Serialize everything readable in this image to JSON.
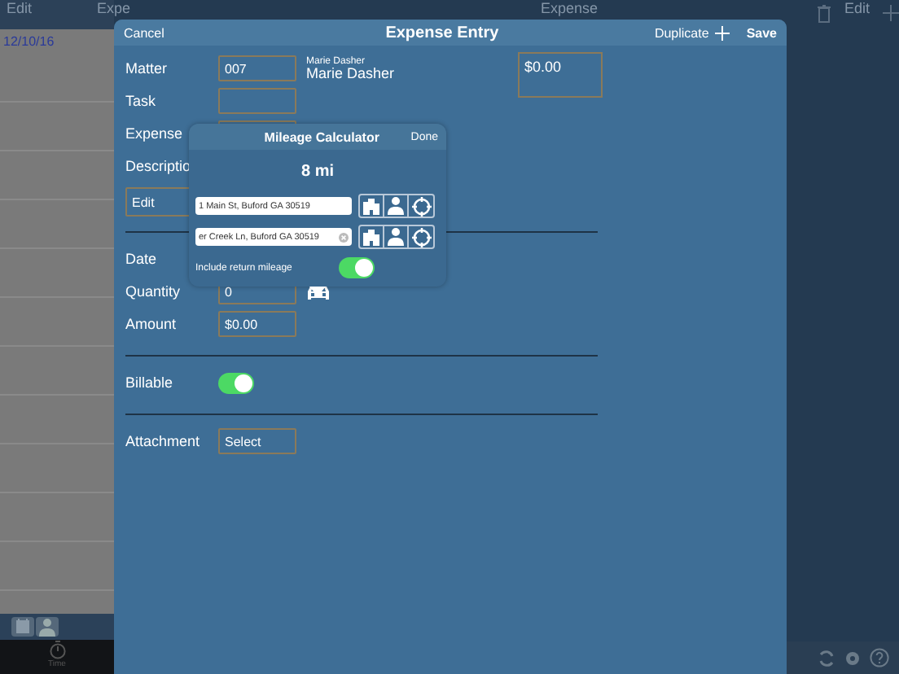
{
  "background": {
    "left_header": {
      "edit": "Edit",
      "title": "Expe"
    },
    "date": "12/10/16",
    "right_header": {
      "title": "Expense",
      "edit": "Edit"
    },
    "tab": {
      "label": "Time"
    }
  },
  "modal": {
    "cancel": "Cancel",
    "title": "Expense Entry",
    "duplicate": "Duplicate",
    "save": "Save",
    "client": {
      "caption": "Marie Dasher",
      "name": "Marie Dasher"
    },
    "total": "$0.00",
    "rows": [
      {
        "kind": "field",
        "label": "Matter",
        "value": "007"
      },
      {
        "kind": "field",
        "label": "Task"
      },
      {
        "kind": "field",
        "label": "Expense"
      },
      {
        "kind": "label",
        "label": "Descriptio"
      },
      {
        "kind": "memo",
        "value": "Edit"
      },
      {
        "kind": "divider"
      },
      {
        "kind": "label",
        "label": "Date"
      },
      {
        "kind": "field",
        "label": "Quantity",
        "value": "0",
        "mileage_button": true
      },
      {
        "kind": "field",
        "label": "Amount",
        "value": "$0.00"
      },
      {
        "kind": "divider"
      },
      {
        "kind": "toggle",
        "label": "Billable",
        "on": true
      },
      {
        "kind": "divider"
      },
      {
        "kind": "field",
        "label": "Attachment",
        "value": "Select"
      }
    ]
  },
  "mileage": {
    "title": "Mileage Calculator",
    "done": "Done",
    "distance": "8 mi",
    "addresses": [
      {
        "value": "1 Main St, Buford GA 30519",
        "clear": false
      },
      {
        "value": "er Creek Ln, Buford GA 30519",
        "clear": true
      }
    ],
    "return_trip": {
      "label": "Include return mileage",
      "on": true
    }
  }
}
